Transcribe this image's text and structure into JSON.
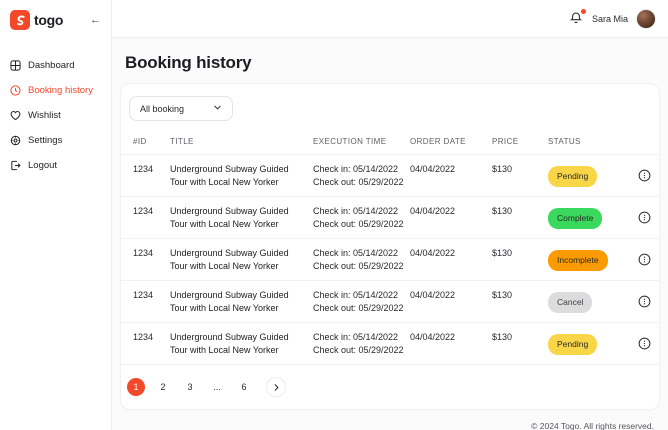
{
  "brand": {
    "name": "togo"
  },
  "sidebar": {
    "items": [
      {
        "label": "Dashboard"
      },
      {
        "label": "Booking history"
      },
      {
        "label": "Wishlist"
      },
      {
        "label": "Settings"
      },
      {
        "label": "Logout"
      }
    ]
  },
  "topbar": {
    "user_name": "Sara Mia"
  },
  "page": {
    "title": "Booking history"
  },
  "filter": {
    "selected": "All booking"
  },
  "table": {
    "headers": [
      "#ID",
      "TITLE",
      "EXECUTION TIME",
      "ORDER DATE",
      "PRICE",
      "STATUS"
    ],
    "rows": [
      {
        "id": "1234",
        "title": "Underground Subway Guided Tour with Local New Yorker",
        "check_in": "Check in: 05/14/2022",
        "check_out": "Check out: 05/29/2022",
        "order_date": "04/04/2022",
        "price": "$130",
        "status": "Pending",
        "status_type": "pending"
      },
      {
        "id": "1234",
        "title": "Underground Subway Guided Tour with Local New Yorker",
        "check_in": "Check in: 05/14/2022",
        "check_out": "Check out: 05/29/2022",
        "order_date": "04/04/2022",
        "price": "$130",
        "status": "Complete",
        "status_type": "complete"
      },
      {
        "id": "1234",
        "title": "Underground Subway Guided Tour with Local New Yorker",
        "check_in": "Check in: 05/14/2022",
        "check_out": "Check out: 05/29/2022",
        "order_date": "04/04/2022",
        "price": "$130",
        "status": "Incomplete",
        "status_type": "incomplete"
      },
      {
        "id": "1234",
        "title": "Underground Subway Guided Tour with Local New Yorker",
        "check_in": "Check in: 05/14/2022",
        "check_out": "Check out: 05/29/2022",
        "order_date": "04/04/2022",
        "price": "$130",
        "status": "Cancel",
        "status_type": "cancel"
      },
      {
        "id": "1234",
        "title": "Underground Subway Guided Tour with Local New Yorker",
        "check_in": "Check in: 05/14/2022",
        "check_out": "Check out: 05/29/2022",
        "order_date": "04/04/2022",
        "price": "$130",
        "status": "Pending",
        "status_type": "pending"
      }
    ]
  },
  "pagination": {
    "pages": [
      "1",
      "2",
      "3",
      "...",
      "6"
    ],
    "active_index": 0
  },
  "footer": {
    "copyright": "© 2024 Togo. All rights reserved."
  },
  "colors": {
    "accent": "#F4482A",
    "pending": "#F8D648",
    "complete": "#3BD85E",
    "incomplete": "#FB9B04",
    "cancel": "#DCDCDC"
  }
}
